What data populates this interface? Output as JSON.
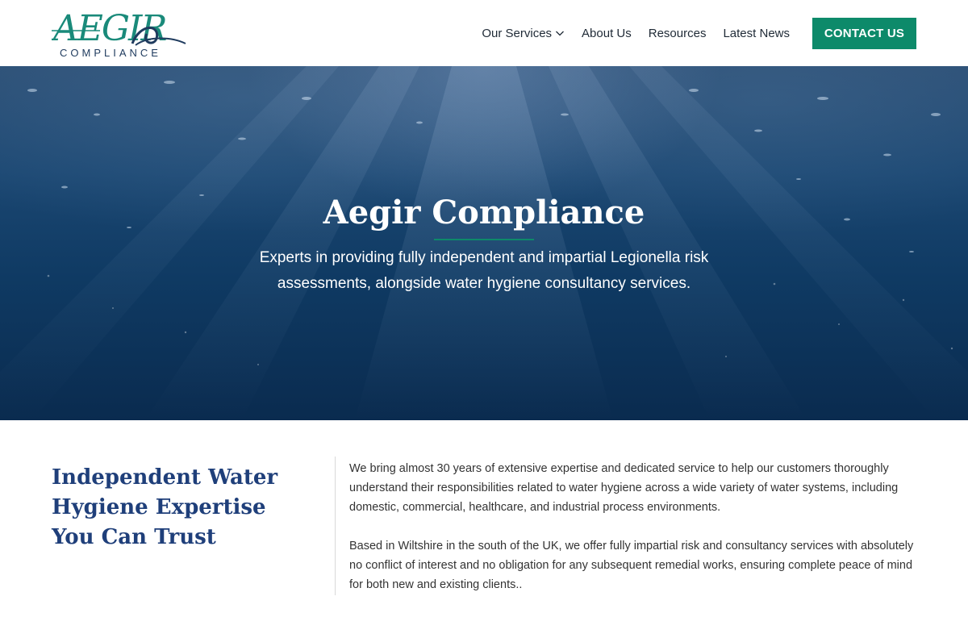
{
  "brand": {
    "logo_text": "AEGIR",
    "logo_subtext": "COMPLIANCE"
  },
  "nav": {
    "items": [
      {
        "label": "Our Services",
        "has_dropdown": true
      },
      {
        "label": "About Us"
      },
      {
        "label": "Resources"
      },
      {
        "label": "Latest News"
      }
    ],
    "contact_label": "CONTACT US"
  },
  "hero": {
    "title": "Aegir Compliance",
    "description": "Experts in providing fully independent and impartial Legionella risk assessments, alongside water hygiene consultancy services."
  },
  "intro": {
    "heading": "Independent Water Hygiene Expertise You Can Trust",
    "paragraphs": [
      "We bring almost 30 years of extensive expertise and dedicated service to help our customers thoroughly understand their responsibilities related to water hygiene across a wide variety of water systems, including domestic, commercial, healthcare, and industrial process environments.",
      "Based in Wiltshire in the south of the UK, we offer fully impartial risk and consultancy services with absolutely no conflict of interest and no obligation for any subsequent remedial works, ensuring complete peace of mind for both new and existing clients.."
    ]
  },
  "colors": {
    "accent": "#0d8a6a",
    "heading": "#1f3f7a",
    "hero_deep": "#0a2b4f"
  },
  "icons": {
    "dropdown": "chevron-down-icon"
  }
}
